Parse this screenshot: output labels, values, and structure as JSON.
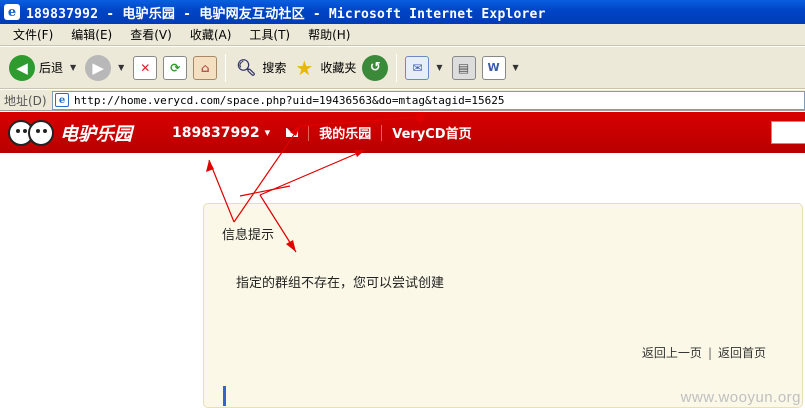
{
  "window": {
    "title": "189837992 - 电驴乐园 - 电驴网友互动社区 - Microsoft Internet Explorer"
  },
  "menubar": {
    "items": [
      {
        "label": "文件(F)"
      },
      {
        "label": "编辑(E)"
      },
      {
        "label": "查看(V)"
      },
      {
        "label": "收藏(A)"
      },
      {
        "label": "工具(T)"
      },
      {
        "label": "帮助(H)"
      }
    ]
  },
  "toolbar": {
    "back_label": "后退",
    "search_label": "搜索",
    "favorites_label": "收藏夹"
  },
  "addressbar": {
    "label": "地址(D)",
    "url": "http://home.verycd.com/space.php?uid=19436563&do=mtag&tagid=15625"
  },
  "site_header": {
    "logo_text": "电驴乐园",
    "username": "189837992",
    "nav_links": [
      "我的乐园",
      "VeryCD首页"
    ]
  },
  "info_box": {
    "title": "信息提示",
    "message": "指定的群组不存在，您可以尝试创建",
    "link_back": "返回上一页",
    "link_separator": "|",
    "link_home": "返回首页"
  },
  "watermark": "www.wooyun.org",
  "colors": {
    "header_red": "#c80000",
    "info_bg": "#fbf8e7",
    "annotation_red": "#e00000"
  }
}
